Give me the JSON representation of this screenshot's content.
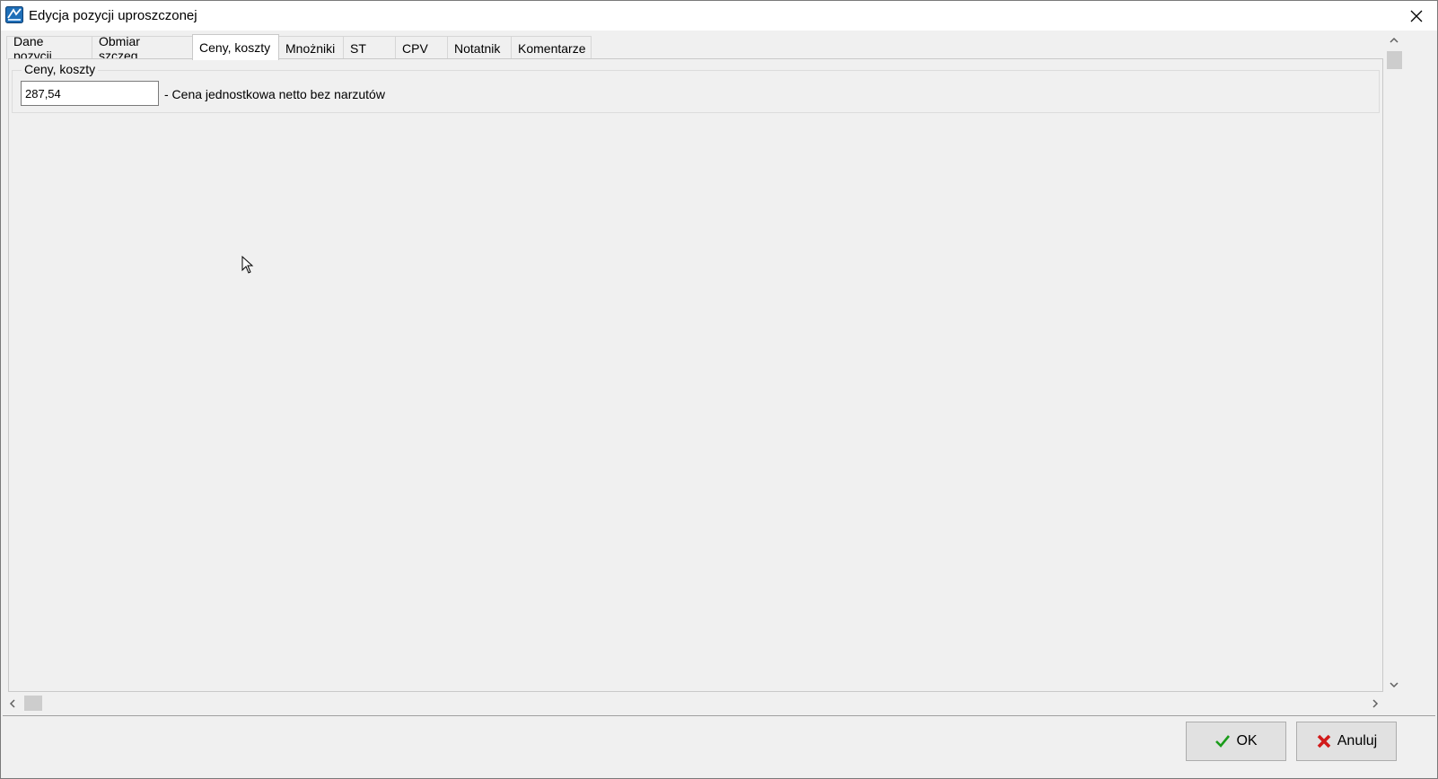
{
  "window": {
    "title": "Edycja pozycji uproszczonej"
  },
  "tabs": [
    {
      "label": "Dane pozycji",
      "active": false
    },
    {
      "label": "Obmiar szczeg.",
      "active": false
    },
    {
      "label": "Ceny, koszty",
      "active": true
    },
    {
      "label": "Mnożniki",
      "active": false
    },
    {
      "label": "ST",
      "active": false
    },
    {
      "label": "CPV",
      "active": false
    },
    {
      "label": "Notatnik",
      "active": false
    },
    {
      "label": "Komentarze",
      "active": false
    }
  ],
  "pricing": {
    "group_title": "Ceny, koszty",
    "unit_price_value": "287,54",
    "unit_price_label": "- Cena jednostkowa netto bez narzutów"
  },
  "buttons": {
    "ok_label": "OK",
    "cancel_label": "Anuluj"
  },
  "colors": {
    "ok_check": "#1a9c1a",
    "cancel_x": "#d11a1a"
  }
}
